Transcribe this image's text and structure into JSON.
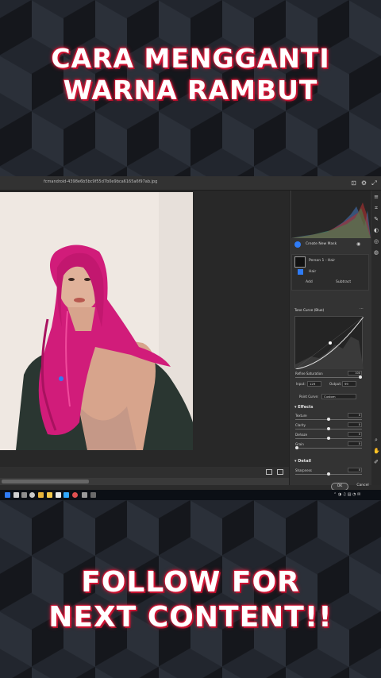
{
  "overlay": {
    "top_line1": "CARA MENGGANTI",
    "top_line2": "WARNA RAMBUT",
    "bottom_line1": "FOLLOW FOR",
    "bottom_line2": "NEXT CONTENT!!"
  },
  "window": {
    "filename": "fcmandroid-4398e6b5bc9f55d7b0e9bca6165a6f97ab.jpg"
  },
  "masking": {
    "create_new_mask": "Create New Mask",
    "person_label": "Person 1 - Hair",
    "hair_label": "Hair",
    "add_label": "Add",
    "subtract_label": "Subtract"
  },
  "tone_curve": {
    "title": "Tone Curve (Blue)",
    "refine_saturation": "Refine Saturation",
    "refine_value": "100",
    "input_label": "Input:",
    "input_value": "129",
    "output_label": "Output:",
    "output_value": "99",
    "point_curve_label": "Point Curve:",
    "point_curve_value": "Custom"
  },
  "effects": {
    "title": "Effects",
    "sliders": [
      {
        "label": "Texture",
        "value": "0",
        "level": 0.5
      },
      {
        "label": "Clarity",
        "value": "0",
        "level": 0.5
      },
      {
        "label": "Dehaze",
        "value": "0",
        "level": 0.5
      },
      {
        "label": "Grain",
        "value": "0",
        "level": 0.0
      }
    ]
  },
  "detail": {
    "title": "Detail",
    "sharpness_label": "Sharpness",
    "sharpness_value": "0"
  },
  "dialog": {
    "ok": "OK",
    "cancel": "Cancel"
  },
  "colors": {
    "accent_red": "#e01a3c",
    "hair_magenta": "#d11c7a",
    "ok_button": "#3b3b3b",
    "mask_blue": "#2f7cf6"
  }
}
